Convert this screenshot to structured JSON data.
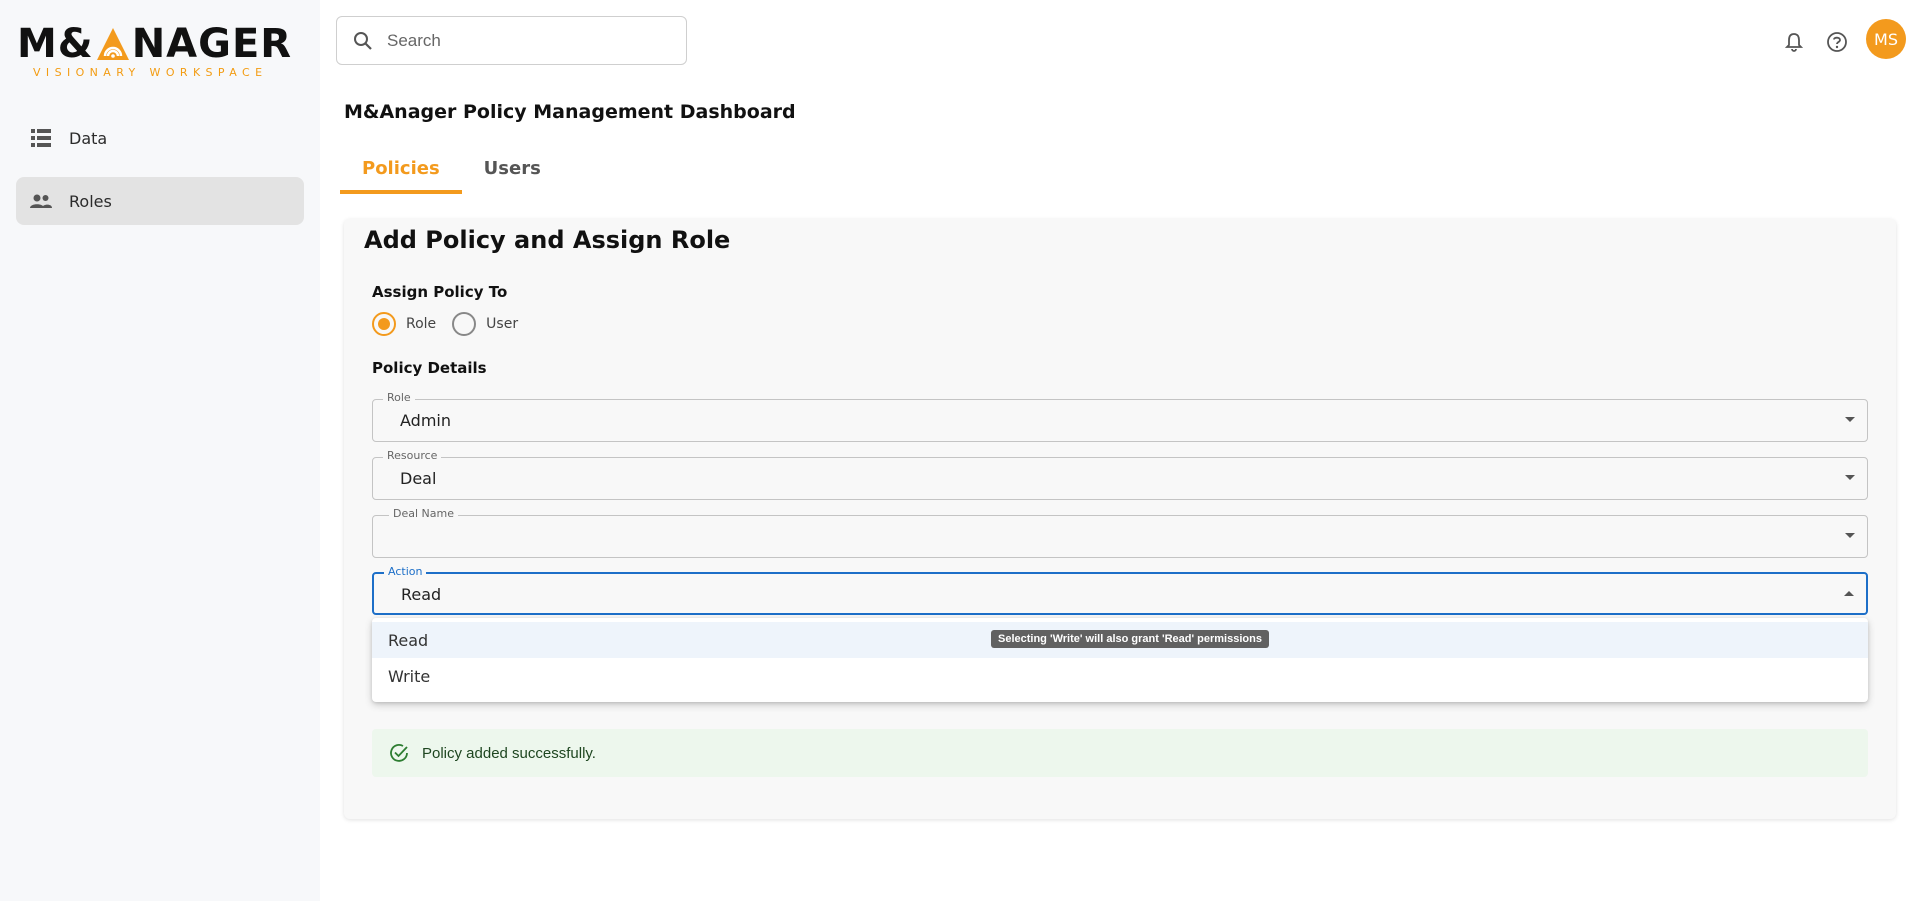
{
  "brand": {
    "name_left": "M&",
    "name_right": "NAGER",
    "tagline": "VISIONARY WORKSPACE",
    "accent": "#f39a1d"
  },
  "sidebar": {
    "items": [
      {
        "label": "Data",
        "icon": "list-icon",
        "active": false
      },
      {
        "label": "Roles",
        "icon": "people-icon",
        "active": true
      }
    ]
  },
  "topbar": {
    "search_placeholder": "Search",
    "avatar_initials": "MS"
  },
  "page": {
    "title": "M&Anager Policy Management Dashboard",
    "tabs": [
      {
        "label": "Policies",
        "active": true
      },
      {
        "label": "Users",
        "active": false
      }
    ]
  },
  "form": {
    "title": "Add Policy and Assign Role",
    "assign_label": "Assign Policy To",
    "assign_options": [
      {
        "label": "Role",
        "selected": true
      },
      {
        "label": "User",
        "selected": false
      }
    ],
    "details_label": "Policy Details",
    "fields": {
      "role": {
        "label": "Role",
        "value": "Admin"
      },
      "resource": {
        "label": "Resource",
        "value": "Deal"
      },
      "deal_name": {
        "label": "Deal Name",
        "value": ""
      },
      "action": {
        "label": "Action",
        "value": "Read"
      }
    },
    "action_options": [
      {
        "label": "Read",
        "selected": true
      },
      {
        "label": "Write",
        "selected": false
      }
    ],
    "tooltip": "Selecting 'Write' will also grant 'Read' permissions",
    "alert": "Policy added successfully."
  }
}
